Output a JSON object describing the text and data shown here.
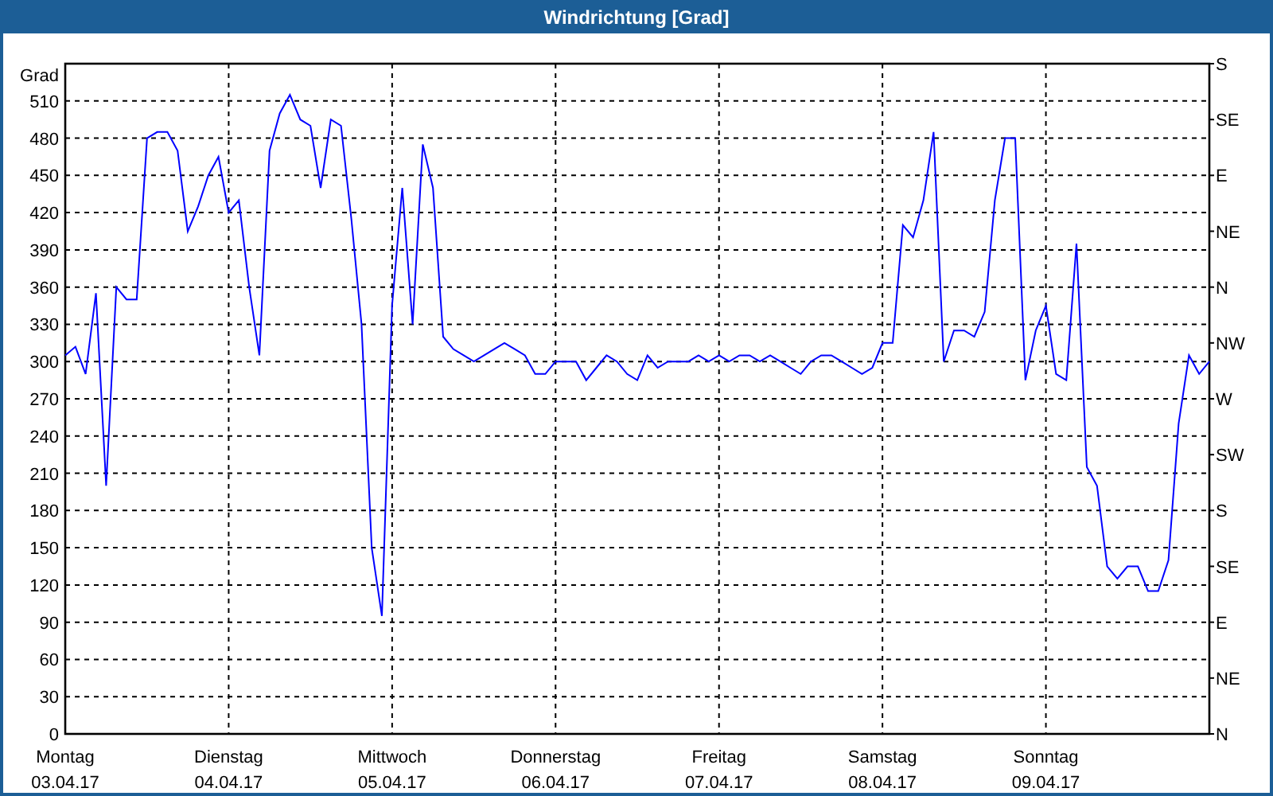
{
  "window": {
    "title": "Windrichtung [Grad]"
  },
  "chart": {
    "chart_data": {
      "type": "line",
      "ylabel": "Grad",
      "ylim": [
        0,
        540
      ],
      "grid": true,
      "yticks": [
        0,
        30,
        60,
        90,
        120,
        150,
        180,
        210,
        240,
        270,
        300,
        330,
        360,
        390,
        420,
        450,
        480,
        510
      ],
      "categories": [
        "Montag",
        null,
        null,
        null,
        null,
        null,
        null,
        null,
        null,
        null,
        null,
        null,
        null,
        null,
        null,
        null,
        "Dienstag",
        null,
        null,
        null,
        null,
        null,
        null,
        null,
        null,
        null,
        null,
        null,
        null,
        null,
        null,
        null,
        "Mittwoch",
        null,
        null,
        null,
        null,
        null,
        null,
        null,
        null,
        null,
        null,
        null,
        null,
        null,
        null,
        null,
        "Donnerstag",
        null,
        null,
        null,
        null,
        null,
        null,
        null,
        null,
        null,
        null,
        null,
        null,
        null,
        null,
        null,
        "Freitag",
        null,
        null,
        null,
        null,
        null,
        null,
        null,
        null,
        null,
        null,
        null,
        null,
        null,
        null,
        null,
        "Samstag",
        null,
        null,
        null,
        null,
        null,
        null,
        null,
        null,
        null,
        null,
        null,
        null,
        null,
        null,
        null,
        "Sonntag",
        null,
        null,
        null,
        null,
        null,
        null,
        null,
        null,
        null,
        null,
        null,
        null,
        null,
        null,
        null,
        null
      ],
      "series": [
        {
          "color": "#0000ff",
          "values": [
            305,
            312,
            290,
            355,
            200,
            360,
            350,
            350,
            480,
            485,
            485,
            470,
            405,
            425,
            450,
            465,
            420,
            430,
            360,
            305,
            470,
            500,
            515,
            495,
            490,
            440,
            495,
            490,
            415,
            330,
            150,
            95,
            345,
            440,
            330,
            475,
            440,
            320,
            310,
            305,
            300,
            305,
            310,
            315,
            310,
            305,
            290,
            290,
            300,
            300,
            300,
            285,
            295,
            305,
            300,
            290,
            285,
            305,
            295,
            300,
            300,
            300,
            305,
            300,
            305,
            300,
            305,
            305,
            300,
            305,
            300,
            295,
            290,
            300,
            305,
            305,
            300,
            295,
            290,
            295,
            315,
            315,
            410,
            400,
            430,
            485,
            300,
            325,
            325,
            320,
            340,
            430,
            480,
            480,
            285,
            325,
            345,
            290,
            285,
            395,
            215,
            200,
            135,
            125,
            135,
            135,
            115,
            115,
            140,
            250,
            305,
            290,
            300
          ]
        }
      ]
    },
    "x_dates": [
      "03.04.17",
      "04.04.17",
      "05.04.17",
      "06.04.17",
      "07.04.17",
      "08.04.17",
      "09.04.17"
    ],
    "right_axis": {
      "ticks": [
        "S",
        "SE",
        "E",
        "NE",
        "N",
        "NW",
        "W",
        "SW",
        "S",
        "SE",
        "E",
        "NE",
        "N"
      ]
    }
  }
}
